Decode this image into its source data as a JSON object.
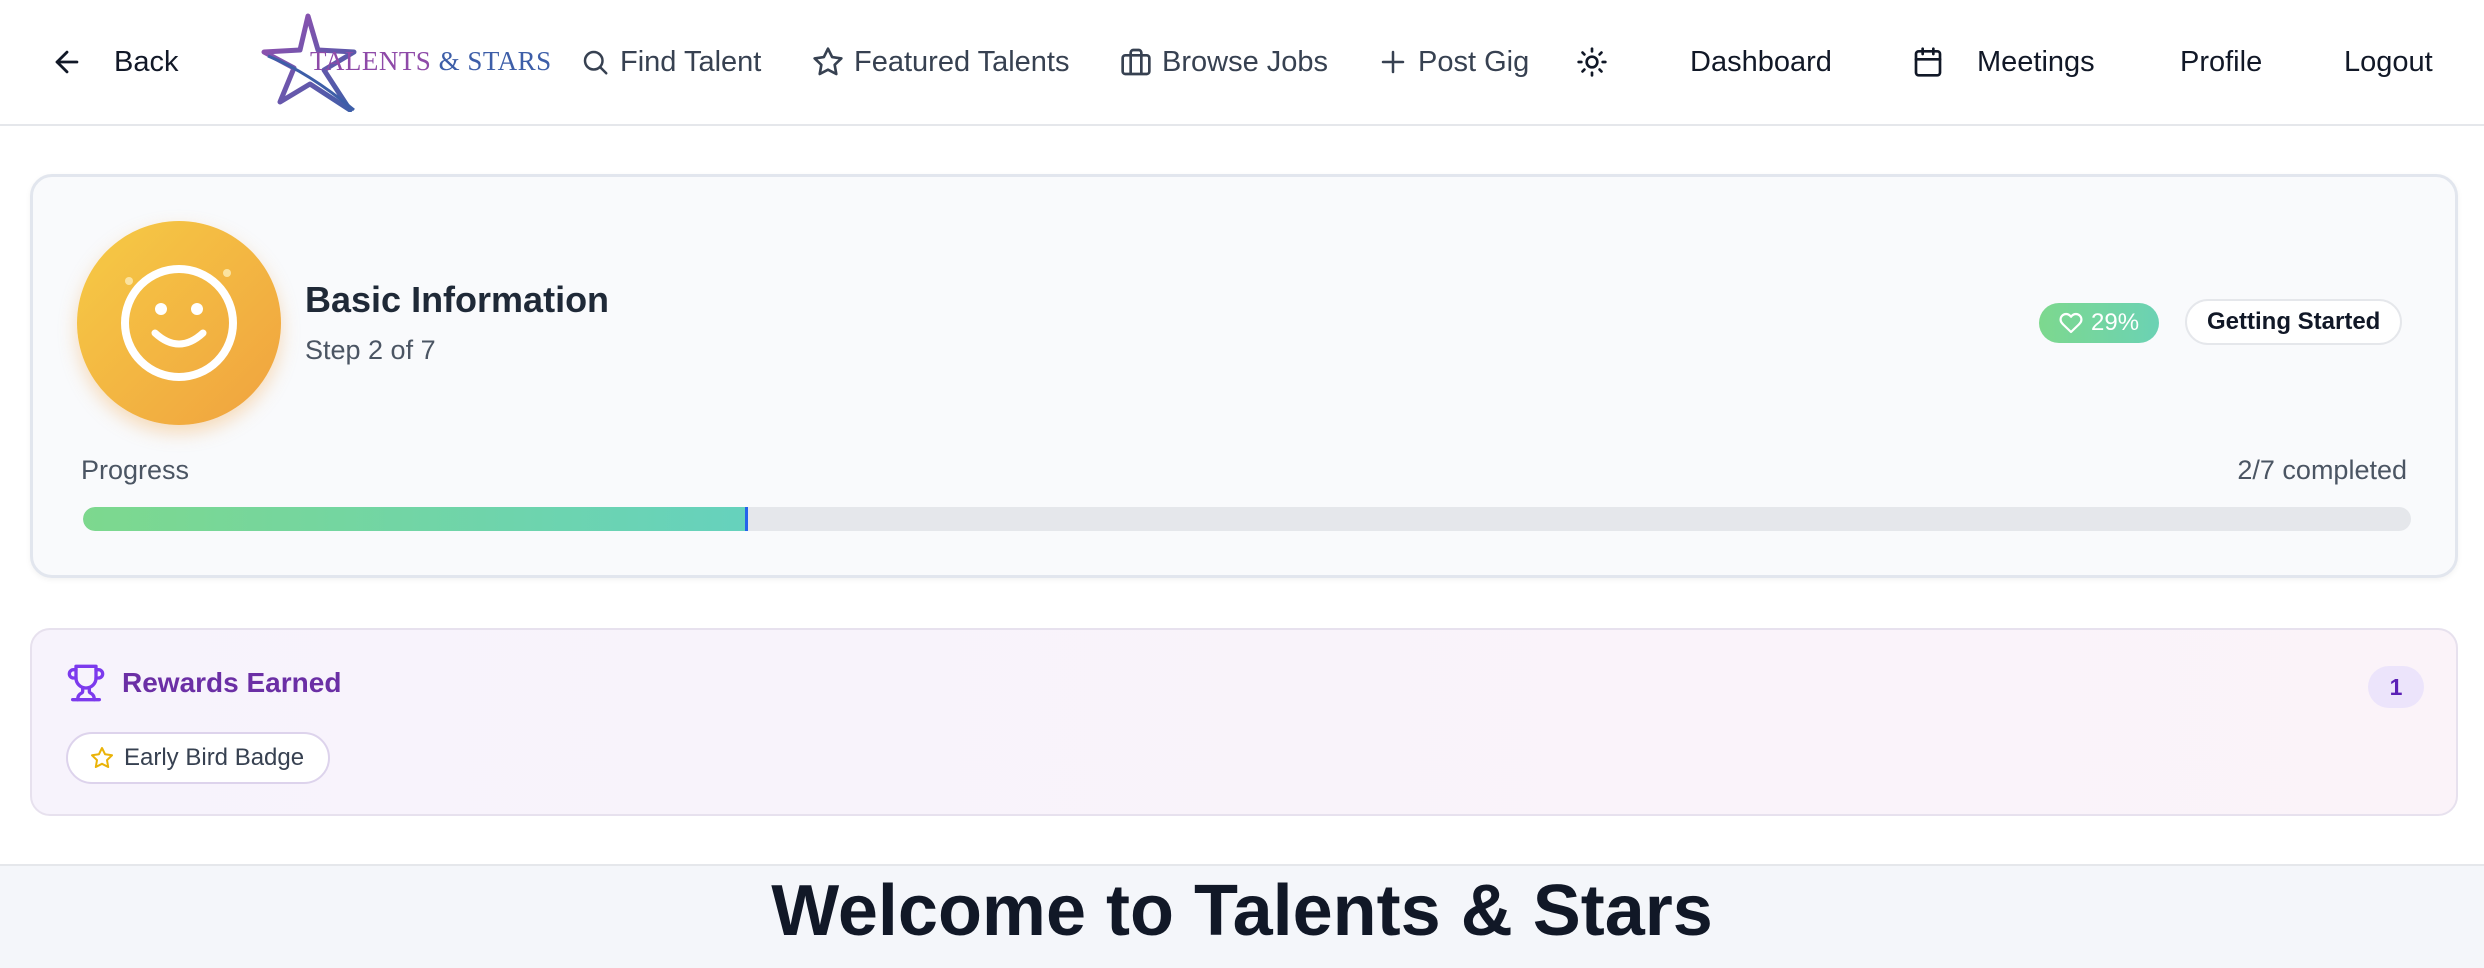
{
  "nav": {
    "back_label": "Back",
    "logo": {
      "text_part1": "TALENTS",
      "text_part2": "& STARS"
    },
    "find_talent": "Find Talent",
    "featured_talents": "Featured Talents",
    "browse_jobs": "Browse Jobs",
    "post_gig": "Post Gig",
    "dashboard": "Dashboard",
    "meetings": "Meetings",
    "profile": "Profile",
    "logout": "Logout"
  },
  "onboarding": {
    "step_title": "Basic Information",
    "step_subtitle": "Step 2 of 7",
    "percent_badge": "29%",
    "status_badge": "Getting Started",
    "progress_label": "Progress",
    "progress_count": "2/7 completed",
    "progress_fraction": 0.2857
  },
  "rewards": {
    "title": "Rewards Earned",
    "count": "1",
    "items": [
      {
        "label": "Early Bird Badge",
        "icon": "star-icon"
      }
    ]
  },
  "welcome": {
    "title": "Welcome to Talents & Stars"
  },
  "colors": {
    "accent_green": "#7dd88e",
    "accent_teal": "#66d2bd",
    "rewards_purple": "#6b2fa5",
    "avatar_yellow": "#f6cb45",
    "avatar_orange": "#f0a23f"
  }
}
